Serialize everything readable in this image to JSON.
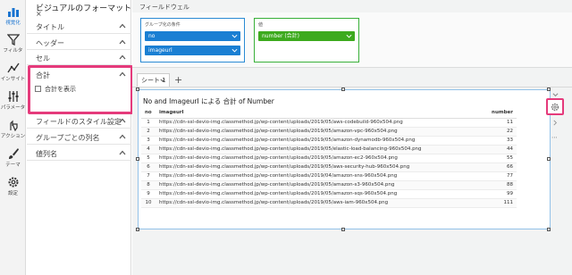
{
  "rail": [
    {
      "label": "視覚化",
      "icon": "bar-chart-icon",
      "active": true
    },
    {
      "label": "フィルタ",
      "icon": "filter-icon",
      "active": false
    },
    {
      "label": "インサイト",
      "icon": "insight-icon",
      "active": false
    },
    {
      "label": "パラメータ",
      "icon": "parameter-icon",
      "active": false
    },
    {
      "label": "アクション",
      "icon": "action-icon",
      "active": false
    },
    {
      "label": "テーマ",
      "icon": "brush-icon",
      "active": false
    },
    {
      "label": "設定",
      "icon": "settings-icon",
      "active": false
    }
  ],
  "panel": {
    "title": "ビジュアルのフォーマット",
    "close": "×",
    "sections": [
      "タイトル",
      "ヘッダー",
      "セル",
      "合計",
      "フィールドのスタイル設定",
      "グループごとの列名",
      "値列名"
    ],
    "total_checkbox_label": "合計を表示",
    "total_checked": false
  },
  "wells": {
    "title": "フィールドウェル",
    "group": {
      "label": "グループ化の条件",
      "fields": [
        "no",
        "imageurl"
      ]
    },
    "value": {
      "label": "値",
      "fields": [
        "number (合計)"
      ]
    }
  },
  "sheet": {
    "tab": "シート 1",
    "add": "+"
  },
  "visual": {
    "title": "No and ImageurI による 合計 of Number",
    "columns": [
      "no",
      "imageurl",
      "number"
    ],
    "rows": [
      [
        "1",
        "https://cdn-ssl-devio-img.classmethod.jp/wp-content/uploads/2019/05/aws-codebuild-960x504.png",
        "11"
      ],
      [
        "2",
        "https://cdn-ssl-devio-img.classmethod.jp/wp-content/uploads/2019/05/amazon-vpc-960x504.png",
        "22"
      ],
      [
        "3",
        "https://cdn-ssl-devio-img.classmethod.jp/wp-content/uploads/2019/05/amazon-dynamodb-960x504.png",
        "33"
      ],
      [
        "4",
        "https://cdn-ssl-devio-img.classmethod.jp/wp-content/uploads/2019/05/elastic-load-balancing-960x504.png",
        "44"
      ],
      [
        "5",
        "https://cdn-ssl-devio-img.classmethod.jp/wp-content/uploads/2019/05/amazon-ec2-960x504.png",
        "55"
      ],
      [
        "6",
        "https://cdn-ssl-devio-img.classmethod.jp/wp-content/uploads/2019/05/aws-security-hub-960x504.png",
        "66"
      ],
      [
        "7",
        "https://cdn-ssl-devio-img.classmethod.jp/wp-content/uploads/2019/04/amazon-sns-960x504.png",
        "77"
      ],
      [
        "8",
        "https://cdn-ssl-devio-img.classmethod.jp/wp-content/uploads/2019/05/amazon-s3-960x504.png",
        "88"
      ],
      [
        "9",
        "https://cdn-ssl-devio-img.classmethod.jp/wp-content/uploads/2019/05/amazon-sqs-960x504.png",
        "99"
      ],
      [
        "10",
        "https://cdn-ssl-devio-img.classmethod.jp/wp-content/uploads/2019/05/aws-iam-960x504.png",
        "111"
      ]
    ]
  },
  "colors": {
    "accent": "#1a7fd3",
    "highlight": "#e53a7b",
    "value_well": "#3daa1e"
  }
}
